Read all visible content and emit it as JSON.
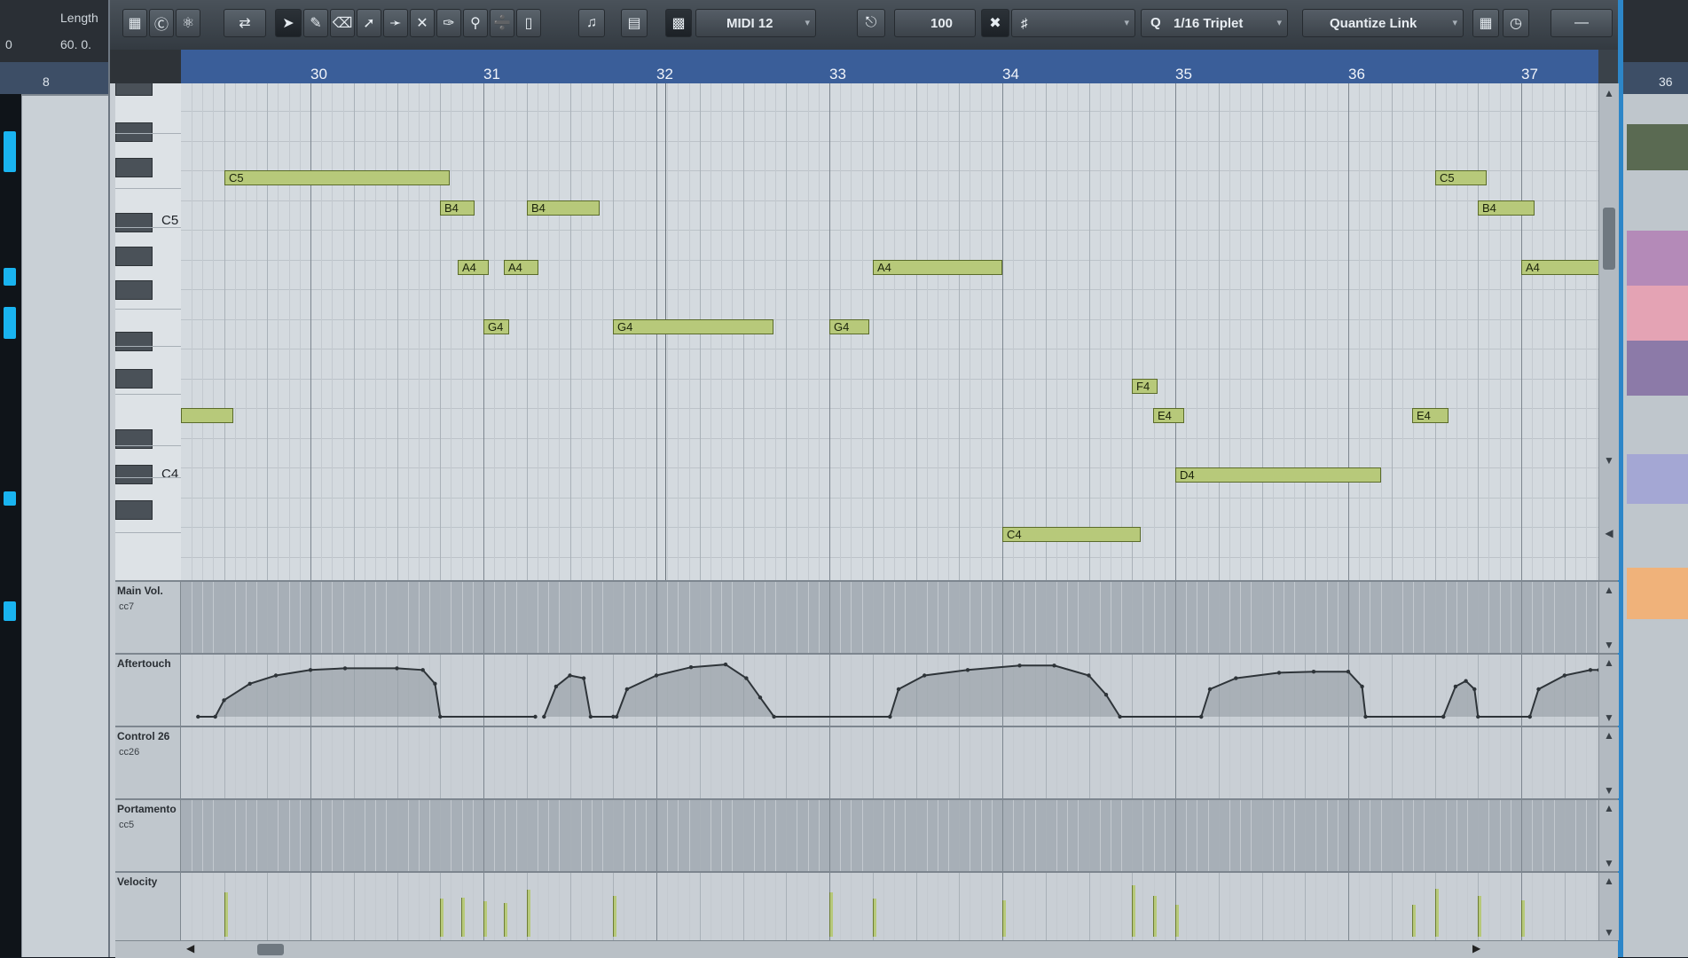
{
  "background_left": {
    "header_label": "Length",
    "values": [
      "0",
      "60. 0."
    ],
    "ruler_number": "8"
  },
  "background_right": {
    "ruler_number": "36"
  },
  "toolbar": {
    "midi_channel": "MIDI 12",
    "velocity_value": "100",
    "quantize_value": "1/16 Triplet",
    "length_quantize": "Quantize Link",
    "icons": [
      "editor-layout-icon",
      "solo-icon",
      "acoustic-feedback-icon",
      "autoscroll-icon",
      "object-selection-icon",
      "draw-icon",
      "erase-icon",
      "line-icon",
      "trim-icon",
      "mute-icon",
      "glue-icon",
      "zoom-icon",
      "scissors-icon",
      "time-warp-icon",
      "snap-icon",
      "quantize-icon",
      "grid-icon"
    ]
  },
  "ruler": {
    "bars": [
      "30",
      "31",
      "32",
      "33",
      "34",
      "35",
      "36",
      "37"
    ]
  },
  "keyboard": {
    "labels": [
      "C5",
      "C4"
    ]
  },
  "notes": [
    {
      "pitch": "",
      "start": 29.25,
      "end": 29.55
    },
    {
      "pitch": "C5",
      "start": 29.5,
      "end": 30.8
    },
    {
      "pitch": "B4",
      "start": 30.75,
      "end": 30.95
    },
    {
      "pitch": "A4",
      "start": 30.85,
      "end": 31.03
    },
    {
      "pitch": "G4",
      "start": 31.0,
      "end": 31.15
    },
    {
      "pitch": "A4",
      "start": 31.12,
      "end": 31.32
    },
    {
      "pitch": "B4",
      "start": 31.25,
      "end": 31.67
    },
    {
      "pitch": "G4",
      "start": 31.75,
      "end": 32.68
    },
    {
      "pitch": "G4",
      "start": 33.0,
      "end": 33.23
    },
    {
      "pitch": "A4",
      "start": 33.25,
      "end": 34.0
    },
    {
      "pitch": "C4",
      "start": 34.0,
      "end": 34.8
    },
    {
      "pitch": "F4",
      "start": 34.75,
      "end": 34.9
    },
    {
      "pitch": "E4",
      "start": 34.87,
      "end": 35.05
    },
    {
      "pitch": "D4",
      "start": 35.0,
      "end": 36.19
    },
    {
      "pitch": "E4",
      "start": 36.37,
      "end": 36.58
    },
    {
      "pitch": "C5",
      "start": 36.5,
      "end": 36.8
    },
    {
      "pitch": "B4",
      "start": 36.75,
      "end": 37.08
    },
    {
      "pitch": "A4",
      "start": 37.0,
      "end": 37.45
    }
  ],
  "lanes": [
    {
      "name": "Main Vol.",
      "cc": "cc7"
    },
    {
      "name": "Aftertouch",
      "cc": ""
    },
    {
      "name": "Control 26",
      "cc": "cc26"
    },
    {
      "name": "Portamento",
      "cc": "cc5"
    },
    {
      "name": "Velocity",
      "cc": ""
    }
  ],
  "velocities": [
    {
      "pos": 29.5,
      "value": 0.75
    },
    {
      "pos": 30.75,
      "value": 0.65
    },
    {
      "pos": 30.87,
      "value": 0.67
    },
    {
      "pos": 31.0,
      "value": 0.6
    },
    {
      "pos": 31.12,
      "value": 0.58
    },
    {
      "pos": 31.25,
      "value": 0.8
    },
    {
      "pos": 31.75,
      "value": 0.7
    },
    {
      "pos": 33.0,
      "value": 0.75
    },
    {
      "pos": 33.25,
      "value": 0.65
    },
    {
      "pos": 34.0,
      "value": 0.62
    },
    {
      "pos": 34.75,
      "value": 0.88
    },
    {
      "pos": 34.87,
      "value": 0.7
    },
    {
      "pos": 35.0,
      "value": 0.55
    },
    {
      "pos": 36.37,
      "value": 0.55
    },
    {
      "pos": 36.5,
      "value": 0.82
    },
    {
      "pos": 36.75,
      "value": 0.7
    },
    {
      "pos": 37.0,
      "value": 0.62
    }
  ],
  "aftertouch_segments": [
    [
      [
        29.35,
        0
      ],
      [
        29.45,
        0
      ],
      [
        29.5,
        0.3
      ],
      [
        29.65,
        0.6
      ],
      [
        29.8,
        0.75
      ],
      [
        30.0,
        0.85
      ],
      [
        30.2,
        0.88
      ],
      [
        30.5,
        0.88
      ],
      [
        30.65,
        0.85
      ],
      [
        30.72,
        0.6
      ],
      [
        30.75,
        0
      ],
      [
        31.3,
        0
      ]
    ],
    [
      [
        31.35,
        0
      ],
      [
        31.42,
        0.55
      ],
      [
        31.5,
        0.75
      ],
      [
        31.58,
        0.7
      ],
      [
        31.62,
        0
      ],
      [
        31.75,
        0
      ]
    ],
    [
      [
        31.77,
        0
      ],
      [
        31.83,
        0.5
      ],
      [
        32.0,
        0.75
      ],
      [
        32.2,
        0.9
      ],
      [
        32.4,
        0.95
      ],
      [
        32.52,
        0.7
      ],
      [
        32.6,
        0.35
      ],
      [
        32.68,
        0
      ],
      [
        33.35,
        0
      ]
    ],
    [
      [
        33.35,
        0
      ],
      [
        33.4,
        0.5
      ],
      [
        33.55,
        0.75
      ],
      [
        33.8,
        0.85
      ],
      [
        34.1,
        0.93
      ],
      [
        34.3,
        0.93
      ],
      [
        34.5,
        0.75
      ],
      [
        34.6,
        0.4
      ],
      [
        34.68,
        0
      ],
      [
        35.15,
        0
      ]
    ],
    [
      [
        35.15,
        0
      ],
      [
        35.2,
        0.5
      ],
      [
        35.35,
        0.7
      ],
      [
        35.6,
        0.8
      ],
      [
        35.8,
        0.82
      ],
      [
        36.0,
        0.82
      ],
      [
        36.08,
        0.55
      ],
      [
        36.1,
        0
      ],
      [
        36.55,
        0
      ]
    ],
    [
      [
        36.55,
        0
      ],
      [
        36.62,
        0.55
      ],
      [
        36.68,
        0.65
      ],
      [
        36.73,
        0.5
      ],
      [
        36.75,
        0
      ],
      [
        37.05,
        0
      ]
    ],
    [
      [
        37.05,
        0
      ],
      [
        37.1,
        0.5
      ],
      [
        37.25,
        0.75
      ],
      [
        37.4,
        0.85
      ],
      [
        37.45,
        0.85
      ]
    ]
  ]
}
